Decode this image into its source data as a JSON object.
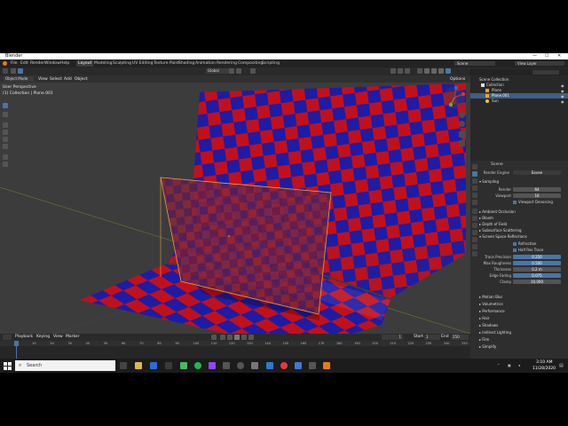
{
  "app": {
    "title": "Blender",
    "window_controls": [
      "—",
      "☐",
      "✕"
    ]
  },
  "menu": [
    "File",
    "Edit",
    "Render",
    "Window",
    "Help"
  ],
  "workspaces": [
    "Layout",
    "Modeling",
    "Sculpting",
    "UV Editing",
    "Texture Paint",
    "Shading",
    "Animation",
    "Rendering",
    "Compositing",
    "Scripting"
  ],
  "header_right": {
    "scene": "Scene",
    "view_layer": "View Layer"
  },
  "viewport": {
    "mode": "Object Mode",
    "menus": [
      "View",
      "Select",
      "Add",
      "Object"
    ],
    "transform": "Global",
    "info_line1": "User Perspective",
    "info_line2": "(1) Collection | Plane.001",
    "options": "Options"
  },
  "timeline": {
    "menus": [
      "Playback",
      "Keying",
      "View",
      "Marker"
    ],
    "current_frame": "1",
    "start_label": "Start",
    "start": "1",
    "end_label": "End",
    "end": "250",
    "ticks": [
      "0",
      "10",
      "20",
      "30",
      "40",
      "50",
      "60",
      "70",
      "80",
      "90",
      "100",
      "110",
      "120",
      "130",
      "140",
      "150",
      "160",
      "170",
      "180",
      "190",
      "200",
      "210",
      "220",
      "230",
      "240",
      "250"
    ]
  },
  "outliner": {
    "root": "Scene Collection",
    "items": [
      {
        "label": "Collection"
      },
      {
        "label": "Plane"
      },
      {
        "label": "Plane.001"
      },
      {
        "label": "Sun"
      }
    ]
  },
  "properties": {
    "scene_label": "Scene",
    "render_engine_label": "Render Engine",
    "render_engine": "Eevee",
    "sampling": "Sampling",
    "render_label": "Render",
    "render_value": "64",
    "viewport_label": "Viewport",
    "viewport_value": "16",
    "viewport_denoising": "Viewport Denoising",
    "sections": [
      "Ambient Occlusion",
      "Bloom",
      "Depth of Field",
      "Subsurface Scattering",
      "Screen Space Reflections"
    ],
    "refraction": "Refraction",
    "half_res_trace": "Half Res Trace",
    "ssr_fields": [
      {
        "label": "Trace Precision",
        "value": "0.250"
      },
      {
        "label": "Max Roughness",
        "value": "0.500"
      },
      {
        "label": "Thickness",
        "value": "0.2 m"
      },
      {
        "label": "Edge Fading",
        "value": "0.075"
      },
      {
        "label": "Clamp",
        "value": "10.000"
      }
    ],
    "sections2": [
      "Motion Blur",
      "Volumetrics",
      "Performance",
      "Hair",
      "Shadows",
      "Indirect Lighting",
      "Film",
      "Simplify"
    ]
  },
  "status": {
    "left": "Add Strip",
    "version": "2.92.0"
  },
  "taskbar": {
    "search": "Search",
    "time": "3:10 AM",
    "date": "11/28/2020"
  },
  "colors": {
    "red": "#c2101a",
    "blue": "#1d1ca6",
    "selection_orange": "#e8a33a",
    "accent_blue": "#4a75a8"
  }
}
